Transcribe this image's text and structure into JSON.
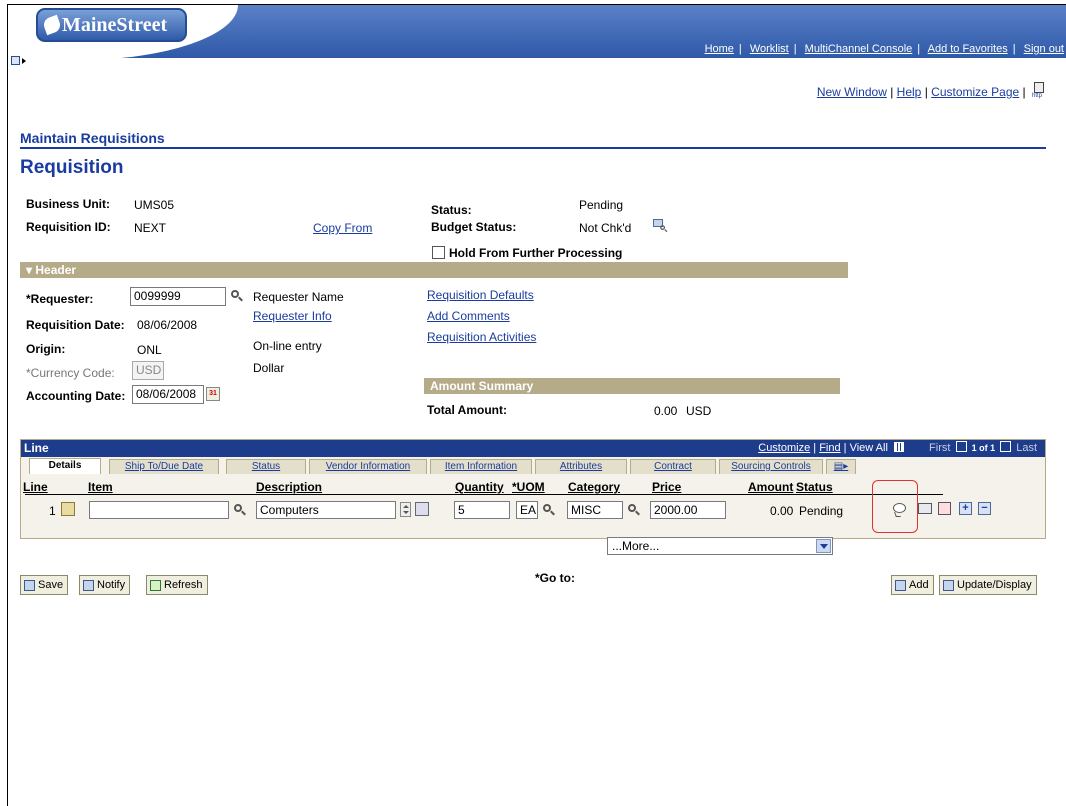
{
  "app": {
    "logo_text": "MaineStreet",
    "top_links": [
      "Home",
      "Worklist",
      "MultiChannel Console",
      "Add to Favorites",
      "Sign out"
    ],
    "page_links": [
      "New Window",
      "Help",
      "Customize Page"
    ],
    "http_icon_text": "http"
  },
  "page": {
    "component_title": "Maintain Requisitions",
    "page_title": "Requisition"
  },
  "summary": {
    "business_unit_label": "Business Unit:",
    "business_unit": "UMS05",
    "requisition_id_label": "Requisition ID:",
    "requisition_id": "NEXT",
    "copy_from": "Copy From",
    "status_label": "Status:",
    "status": "Pending",
    "budget_status_label": "Budget Status:",
    "budget_status": "Not Chk'd",
    "hold_label": "Hold From Further Processing"
  },
  "header": {
    "section_title": "Header",
    "requester_label": "*Requester:",
    "requester_value": "0099999",
    "requester_name": "Requester Name",
    "requester_info": "Requester Info",
    "req_date_label": "Requisition Date:",
    "req_date": "08/06/2008",
    "origin_label": "Origin:",
    "origin": "ONL",
    "origin_desc": "On-line entry",
    "currency_label": "*Currency Code:",
    "currency": "USD",
    "currency_desc": "Dollar",
    "acct_date_label": "Accounting Date:",
    "acct_date": "08/06/2008",
    "calendar_icon_text": "31",
    "links": [
      "Requisition Defaults",
      "Add Comments",
      "Requisition Activities"
    ],
    "amount_summary_title": "Amount Summary",
    "total_amount_label": "Total Amount:",
    "total_amount": "0.00",
    "total_currency": "USD"
  },
  "line_grid": {
    "title": "Line",
    "customize": "Customize",
    "find": "Find",
    "view_all": "View All",
    "first": "First",
    "page_info": "1 of 1",
    "last": "Last",
    "tabs": [
      "Details",
      "Ship To/Due Date",
      "Status",
      "Vendor Information",
      "Item Information",
      "Attributes",
      "Contract",
      "Sourcing Controls"
    ],
    "columns": [
      "Line",
      "Item",
      "Description",
      "Quantity",
      "*UOM",
      "Category",
      "Price",
      "Amount",
      "Status"
    ],
    "row": {
      "line": "1",
      "item": "",
      "description": "Computers",
      "quantity": "5",
      "uom": "EA",
      "category": "MISC",
      "price": "2000.00",
      "amount": "0.00",
      "status": "Pending"
    },
    "add_row_glyph": "+",
    "delete_row_glyph": "−"
  },
  "goto": {
    "label": "*Go to:",
    "selected": "...More..."
  },
  "toolbar": {
    "save": "Save",
    "notify": "Notify",
    "refresh": "Refresh",
    "add": "Add",
    "update_display": "Update/Display"
  }
}
